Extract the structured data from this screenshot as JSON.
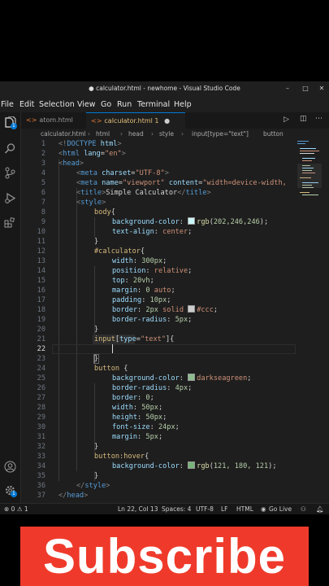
{
  "window": {
    "title": "● calculator.html - newhome - Visual Studio Code"
  },
  "menu": [
    "File",
    "Edit",
    "Selection",
    "View",
    "Go",
    "Run",
    "Terminal",
    "Help"
  ],
  "activity_badge": "1",
  "settings_badge": "1",
  "tabs": [
    {
      "label": "atom.html"
    },
    {
      "label": "calculator.html 1",
      "modified_dot": "●"
    }
  ],
  "breadcrumbs": [
    "calculator.html",
    "html",
    "head",
    "style",
    "input[type=\"text\"]",
    "button"
  ],
  "code_lines": [
    {
      "n": "1",
      "text": "<!DOCTYPE html>"
    },
    {
      "n": "2",
      "text": "<html lang=\"en\">"
    },
    {
      "n": "3",
      "text": "<head>"
    },
    {
      "n": "4",
      "text": "<meta charset=\"UTF-8\">"
    },
    {
      "n": "5",
      "text": "<meta name=\"viewport\" content=\"width=device-width,"
    },
    {
      "n": "6",
      "text": "<title>Simple Calculator</title>"
    },
    {
      "n": "7",
      "text": "<style>"
    },
    {
      "n": "8",
      "text": "body{"
    },
    {
      "n": "9",
      "text": "background-color: rgb(202,246,246);"
    },
    {
      "n": "10",
      "text": "text-align: center;"
    },
    {
      "n": "11",
      "text": "}"
    },
    {
      "n": "12",
      "text": "#calculator{"
    },
    {
      "n": "13",
      "text": "width: 300px;"
    },
    {
      "n": "14",
      "text": "position: relative;"
    },
    {
      "n": "15",
      "text": "top: 20vh;"
    },
    {
      "n": "16",
      "text": "margin: 0 auto;"
    },
    {
      "n": "17",
      "text": "padding: 10px;"
    },
    {
      "n": "18",
      "text": "border: 2px solid #ccc;"
    },
    {
      "n": "19",
      "text": "border-radius: 5px;"
    },
    {
      "n": "20",
      "text": "}"
    },
    {
      "n": "21",
      "text": "input[type=\"text\"]{"
    },
    {
      "n": "22",
      "text": ""
    },
    {
      "n": "23",
      "text": "}"
    },
    {
      "n": "24",
      "text": "button {"
    },
    {
      "n": "25",
      "text": "background-color: darkseagreen;"
    },
    {
      "n": "26",
      "text": "border-radius: 4px;"
    },
    {
      "n": "27",
      "text": "border: 0;"
    },
    {
      "n": "28",
      "text": "width: 50px;"
    },
    {
      "n": "29",
      "text": "height: 50px;"
    },
    {
      "n": "30",
      "text": "font-size: 24px;"
    },
    {
      "n": "31",
      "text": "margin: 5px;"
    },
    {
      "n": "32",
      "text": "}"
    },
    {
      "n": "33",
      "text": "button:hover{"
    },
    {
      "n": "34",
      "text": "background-color: rgb(121, 180, 121);"
    },
    {
      "n": "35",
      "text": "}"
    },
    {
      "n": "36",
      "text": "</style>"
    },
    {
      "n": "37",
      "text": "</head>"
    }
  ],
  "swatch_colors": {
    "body_bg": "#caf6f6",
    "border": "#cccccc",
    "button_bg": "#8fbc8f",
    "hover": "#79b479"
  },
  "status": {
    "problems": "⊗ 0 ⚠ 1",
    "position": "Ln 22, Col 13",
    "spaces": "Spaces: 4",
    "encoding": "UTF-8",
    "eol": "LF",
    "language": "HTML",
    "golive": "Go Live"
  },
  "banner": {
    "text": "Subscribe",
    "color": "#ef3a2b"
  }
}
